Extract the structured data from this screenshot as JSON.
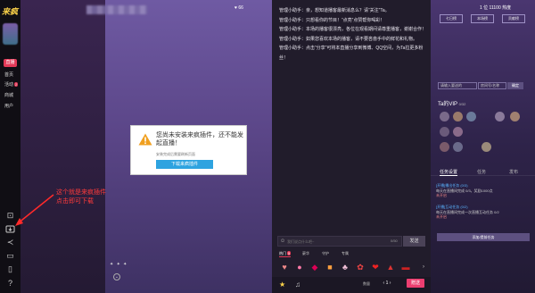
{
  "app": {
    "logo": "来疯"
  },
  "leftnav": {
    "live_badge": "直播",
    "items": [
      {
        "label": "首页"
      },
      {
        "label": "活动",
        "badge": "2"
      },
      {
        "label": "商城"
      },
      {
        "label": "用户"
      }
    ]
  },
  "stage": {
    "viewers": "♥ 66",
    "sparkle": "✦ ✦ ✦",
    "dialog": {
      "message": "您尚未安装来疯插件，还不能发起直播！",
      "sub": "安装完成后需要刷新页面",
      "button": "下载来疯插件"
    }
  },
  "annotation": {
    "line1": "这个就是来疯插件",
    "line2": "点击即可下载"
  },
  "chat": {
    "messages": [
      "管理小助手：亲，想知道播客最新消息么？请“关注”Ta。",
      "管理小助手：只想看你的节目！“点亮”点赞帮你喝彩！",
      "管理小助手：本场的播客很漂亮，各位在观看期间请尊重播客，谢谢合作！",
      "管理小助手：如果您喜欢本场的播客，请不要吝啬手中的鲜花和礼物。",
      "管理小助手：点击“分享”可将本直播分享到微博、QQ空间，为Ta拉更多粉丝！"
    ],
    "input_placeholder": "我们说点什么吧~",
    "count": "0/50",
    "send": "发送",
    "gift_tabs": [
      "热门",
      "豪华",
      "守护",
      "专属"
    ],
    "gift_tab_badge": "5",
    "quantity_label": "数量",
    "quantity": "1",
    "give": "赠送"
  },
  "right": {
    "header": "1 位        11100 热度",
    "tabs": [
      "七日榜",
      "本场榜",
      "贡献榜"
    ],
    "input_placeholder": "请输入要送的",
    "input2_placeholder": "房间号/名称",
    "submit": "确定",
    "vip_title": "Ta的VIP",
    "vip_count": "0/32",
    "task_tabs": [
      "任务设置",
      "任务",
      "发布"
    ],
    "tasks": [
      {
        "title": "[开播]播出任务 (0/3)",
        "desc": "每天在直播间完成 0/3，奖励1000点",
        "state": "未开启"
      },
      {
        "title": "[开播]互动任务 (0/2)",
        "desc": "每天在直播间完成一次直播互动任务 0/2",
        "state": "未开启"
      }
    ],
    "claim": "添加/提前任务"
  },
  "colors": {
    "accent": "#e33a58",
    "dialog_button": "#2ea3e0",
    "annotation": "#ff3b3b"
  }
}
